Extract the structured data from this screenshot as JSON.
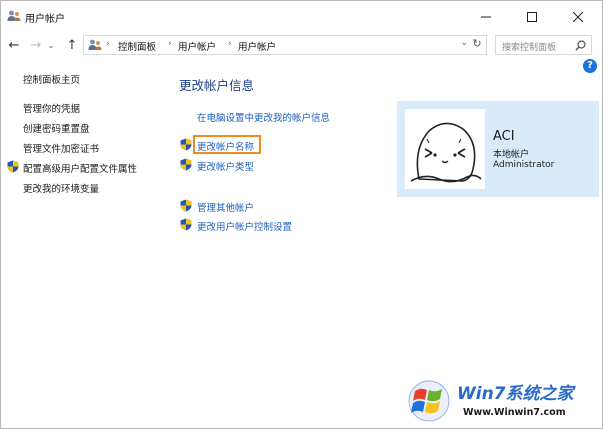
{
  "window": {
    "title": "用户帐户",
    "controls": {
      "minimize": "—",
      "maximize": "☐",
      "close": "✕"
    }
  },
  "nav": {
    "back": "←",
    "forward": "→",
    "recent": "⌄",
    "up": "↑",
    "breadcrumb": [
      "控制面板",
      "用户帐户",
      "用户帐户"
    ],
    "separator": "›",
    "dropdown": "⌄",
    "refresh": "↻",
    "search_placeholder": "搜索控制面板"
  },
  "help": "?",
  "sidebar": {
    "items": [
      {
        "label": "控制面板主页",
        "shield": false
      },
      {
        "label": "管理你的凭据",
        "shield": false
      },
      {
        "label": "创建密码重置盘",
        "shield": false
      },
      {
        "label": "管理文件加密证书",
        "shield": false
      },
      {
        "label": "配置高级用户配置文件属性",
        "shield": true
      },
      {
        "label": "更改我的环境变量",
        "shield": false
      }
    ]
  },
  "main": {
    "title": "更改帐户信息",
    "pc_settings_link": "在电脑设置中更改我的帐户信息",
    "links": [
      {
        "label": "更改帐户名称",
        "shield": true,
        "highlighted": true
      },
      {
        "label": "更改帐户类型",
        "shield": true,
        "highlighted": false
      },
      {
        "label": "管理其他帐户",
        "shield": true,
        "highlighted": false
      },
      {
        "label": "更改用户帐户控制设置",
        "shield": true,
        "highlighted": false
      }
    ]
  },
  "account": {
    "name": "ACI",
    "type": "本地帐户",
    "group": "Administrator"
  },
  "watermark": {
    "brand": "Win7系统之家",
    "url": "Www.Winwin7.com"
  },
  "colors": {
    "link": "#1c5fbf",
    "title": "#1e3f8a",
    "card_bg": "#d9ebfa",
    "highlight": "#f08a1c",
    "help": "#1e72d8"
  }
}
